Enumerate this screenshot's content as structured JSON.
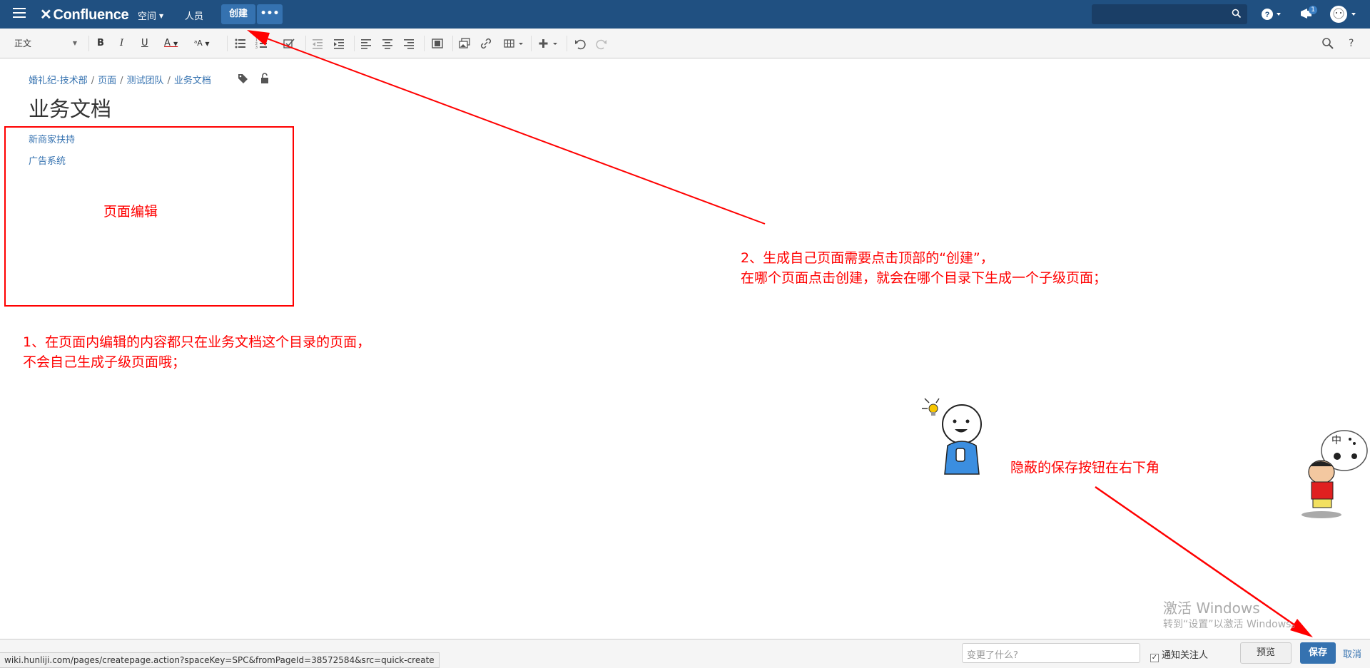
{
  "topnav": {
    "logo": "Confluence",
    "spaces_label": "空间",
    "people_label": "人员",
    "create_label": "创建",
    "more_label": "•••",
    "notification_count": "1"
  },
  "editor": {
    "paragraph_style": "正文",
    "breadcrumb": [
      "婚礼纪-技术部",
      "页面",
      "测试团队",
      "业务文档"
    ],
    "title": "业务文档",
    "links": [
      "新商家扶持",
      "广告系统"
    ]
  },
  "annotations": {
    "box_label": "页面编辑",
    "note1_line1": "1、在页面内编辑的内容都只在业务文档这个目录的页面，",
    "note1_line2": "不会自己生成子级页面哦；",
    "note2_line1": "2、生成自己页面需要点击顶部的“创建”，",
    "note2_line2": "在哪个页面点击创建，就会在哪个目录下生成一个子级页面；",
    "note3": "隐蔽的保存按钮在右下角",
    "colors": {
      "annotation": "#ff0000",
      "nav": "#205081",
      "link": "#3572b0"
    }
  },
  "footer": {
    "change_placeholder": "变更了什么?",
    "notify_label": "通知关注人",
    "notify_checked": true,
    "preview_label": "预览",
    "save_label": "保存",
    "cancel_label": "取消"
  },
  "statusbar": {
    "url": "wiki.hunliji.com/pages/createpage.action?spaceKey=SPC&fromPageId=38572584&src=quick-create"
  },
  "watermark": {
    "line1": "激活 Windows",
    "line2": "转到“设置”以激活 Windows。"
  }
}
